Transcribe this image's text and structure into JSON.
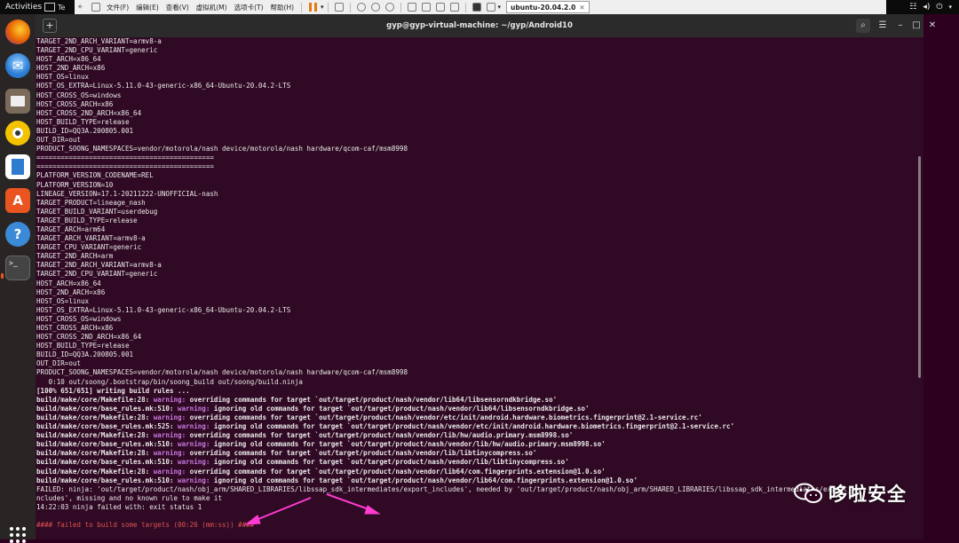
{
  "topbar": {
    "activities": "Activities",
    "vm_app_label": "Te",
    "menus": [
      "文件(F)",
      "编辑(E)",
      "查看(V)",
      "虚拟机(M)",
      "选项卡(T)",
      "帮助(H)"
    ],
    "vm_tab": "ubuntu-20.04.2.0",
    "tray_icons": [
      "network-icon",
      "volume-icon",
      "power-icon"
    ]
  },
  "window": {
    "title": "gyp@gyp-virtual-machine: ~/gyp/Android10"
  },
  "dock": {
    "apps": [
      {
        "name": "firefox-icon",
        "color": "#e66000"
      },
      {
        "name": "thunderbird-icon",
        "color": "#2a7bd3"
      },
      {
        "name": "files-icon",
        "color": "#7a6a5a"
      },
      {
        "name": "rhythmbox-icon",
        "color": "#e8b700"
      },
      {
        "name": "writer-icon",
        "color": "#2e7bcf"
      },
      {
        "name": "software-icon",
        "color": "#e95420"
      },
      {
        "name": "help-icon",
        "color": "#3a8ad8"
      },
      {
        "name": "terminal-icon",
        "color": "#3c3c3c"
      }
    ]
  },
  "terminal": {
    "lines": [
      {
        "t": "TARGET_2ND_ARCH_VARIANT=armv8-a"
      },
      {
        "t": "TARGET_2ND_CPU_VARIANT=generic"
      },
      {
        "t": "HOST_ARCH=x86_64"
      },
      {
        "t": "HOST_2ND_ARCH=x86"
      },
      {
        "t": "HOST_OS=linux"
      },
      {
        "t": "HOST_OS_EXTRA=Linux-5.11.0-43-generic-x86_64-Ubuntu-20.04.2-LTS"
      },
      {
        "t": "HOST_CROSS_OS=windows"
      },
      {
        "t": "HOST_CROSS_ARCH=x86"
      },
      {
        "t": "HOST_CROSS_2ND_ARCH=x86_64"
      },
      {
        "t": "HOST_BUILD_TYPE=release"
      },
      {
        "t": "BUILD_ID=QQ3A.200805.001"
      },
      {
        "t": "OUT_DIR=out"
      },
      {
        "t": "PRODUCT_SOONG_NAMESPACES=vendor/motorola/nash device/motorola/nash hardware/qcom-caf/msm8998"
      },
      {
        "t": "============================================"
      },
      {
        "t": "============================================"
      },
      {
        "t": "PLATFORM_VERSION_CODENAME=REL"
      },
      {
        "t": "PLATFORM_VERSION=10"
      },
      {
        "t": "LINEAGE_VERSION=17.1-20211222-UNOFFICIAL-nash"
      },
      {
        "t": "TARGET_PRODUCT=lineage_nash"
      },
      {
        "t": "TARGET_BUILD_VARIANT=userdebug"
      },
      {
        "t": "TARGET_BUILD_TYPE=release"
      },
      {
        "t": "TARGET_ARCH=arm64"
      },
      {
        "t": "TARGET_ARCH_VARIANT=armv8-a"
      },
      {
        "t": "TARGET_CPU_VARIANT=generic"
      },
      {
        "t": "TARGET_2ND_ARCH=arm"
      },
      {
        "t": "TARGET_2ND_ARCH_VARIANT=armv8-a"
      },
      {
        "t": "TARGET_2ND_CPU_VARIANT=generic"
      },
      {
        "t": "HOST_ARCH=x86_64"
      },
      {
        "t": "HOST_2ND_ARCH=x86"
      },
      {
        "t": "HOST_OS=linux"
      },
      {
        "t": "HOST_OS_EXTRA=Linux-5.11.0-43-generic-x86_64-Ubuntu-20.04.2-LTS"
      },
      {
        "t": "HOST_CROSS_OS=windows"
      },
      {
        "t": "HOST_CROSS_ARCH=x86"
      },
      {
        "t": "HOST_CROSS_2ND_ARCH=x86_64"
      },
      {
        "t": "HOST_BUILD_TYPE=release"
      },
      {
        "t": "BUILD_ID=QQ3A.200805.001"
      },
      {
        "t": "OUT_DIR=out"
      },
      {
        "t": "PRODUCT_SOONG_NAMESPACES=vendor/motorola/nash device/motorola/nash hardware/qcom-caf/msm8998"
      },
      {
        "t": "   0:10 out/soong/.bootstrap/bin/soong_build out/soong/build.ninja"
      },
      {
        "t": "[100% 651/651] writing build rules ...",
        "b": true
      },
      {
        "p": "build/make/core/Makefile:28: ",
        "w": "warning:",
        "s": " overriding commands for target `out/target/product/nash/vendor/lib64/libsensorndkbridge.so'"
      },
      {
        "p": "build/make/core/base_rules.mk:510: ",
        "w": "warning:",
        "s": " ignoring old commands for target `out/target/product/nash/vendor/lib64/libsensorndkbridge.so'"
      },
      {
        "p": "build/make/core/Makefile:28: ",
        "w": "warning:",
        "s": " overriding commands for target `out/target/product/nash/vendor/etc/init/android.hardware.biometrics.fingerprint@2.1-service.rc'"
      },
      {
        "p": "build/make/core/base_rules.mk:525: ",
        "w": "warning:",
        "s": " ignoring old commands for target `out/target/product/nash/vendor/etc/init/android.hardware.biometrics.fingerprint@2.1-service.rc'"
      },
      {
        "p": "build/make/core/Makefile:28: ",
        "w": "warning:",
        "s": " overriding commands for target `out/target/product/nash/vendor/lib/hw/audio.primary.msm8998.so'"
      },
      {
        "p": "build/make/core/base_rules.mk:510: ",
        "w": "warning:",
        "s": " ignoring old commands for target `out/target/product/nash/vendor/lib/hw/audio.primary.msm8998.so'"
      },
      {
        "p": "build/make/core/Makefile:28: ",
        "w": "warning:",
        "s": " overriding commands for target `out/target/product/nash/vendor/lib/libtinycompress.so'"
      },
      {
        "p": "build/make/core/base_rules.mk:510: ",
        "w": "warning:",
        "s": " ignoring old commands for target `out/target/product/nash/vendor/lib/libtinycompress.so'"
      },
      {
        "p": "build/make/core/Makefile:28: ",
        "w": "warning:",
        "s": " overriding commands for target `out/target/product/nash/vendor/lib64/com.fingerprints.extension@1.0.so'"
      },
      {
        "p": "build/make/core/base_rules.mk:510: ",
        "w": "warning:",
        "s": " ignoring old commands for target `out/target/product/nash/vendor/lib64/com.fingerprints.extension@1.0.so'"
      },
      {
        "t": "FAILED: ninja: 'out/target/product/nash/obj_arm/SHARED_LIBRARIES/libssap_sdk_intermediates/export_includes', needed by 'out/target/product/nash/obj_arm/SHARED_LIBRARIES/libssap_sdk_intermediates/export_i"
      },
      {
        "t": "ncludes', missing and no known rule to make it"
      },
      {
        "t": "14:22:03 ninja failed with: exit status 1"
      },
      {
        "t": ""
      },
      {
        "t": "#### failed to build some targets (00:26 (mm:ss)) ####",
        "e": true
      }
    ]
  },
  "watermark": {
    "text": "哆啦安全"
  }
}
